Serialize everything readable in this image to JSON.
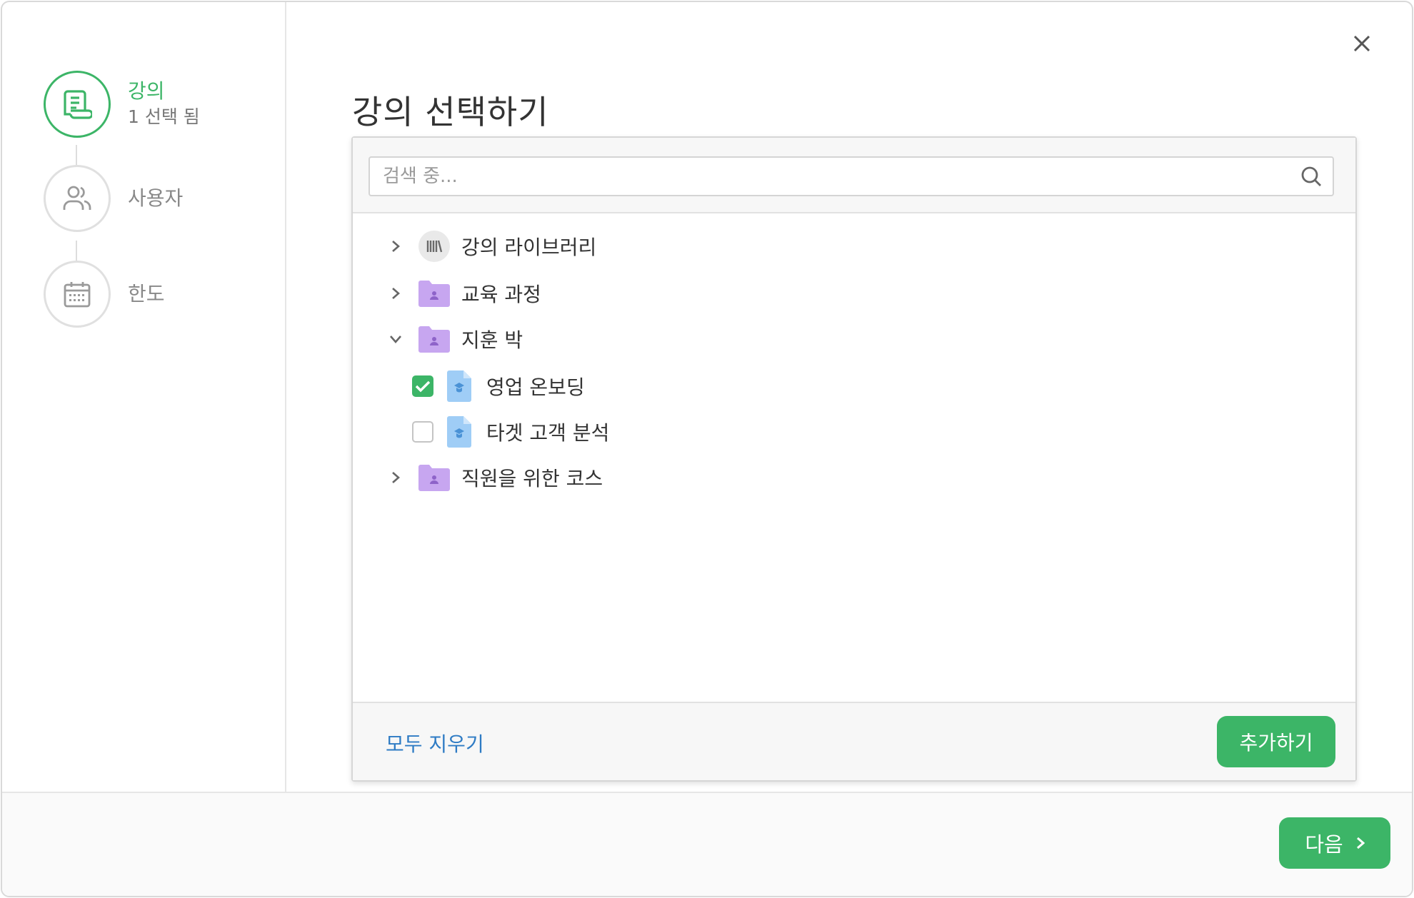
{
  "stepper": {
    "steps": [
      {
        "title": "강의",
        "sub": "1 선택 됨",
        "icon": "course-doc-icon",
        "active": true
      },
      {
        "title": "사용자",
        "sub": "",
        "icon": "users-icon",
        "active": false
      },
      {
        "title": "한도",
        "sub": "",
        "icon": "calendar-icon",
        "active": false
      }
    ]
  },
  "main": {
    "title": "강의 선택하기",
    "close_icon": "close-icon"
  },
  "search": {
    "placeholder": "검색 중...",
    "value": ""
  },
  "tree": {
    "items": [
      {
        "label": "강의 라이브러리",
        "icon": "library-icon",
        "expanded": false
      },
      {
        "label": "교육 과정",
        "icon": "folder-user-icon",
        "expanded": false
      },
      {
        "label": "지훈 박",
        "icon": "folder-user-icon",
        "expanded": true
      },
      {
        "label": "영업 온보딩",
        "icon": "course-file-icon",
        "checked": true
      },
      {
        "label": "타겟 고객 분석",
        "icon": "course-file-icon",
        "checked": false
      },
      {
        "label": "직원을 위한 코스",
        "icon": "folder-user-icon",
        "expanded": false
      }
    ]
  },
  "picker_footer": {
    "clear_label": "모두 지우기",
    "add_label": "추가하기"
  },
  "footer": {
    "next_label": "다음"
  },
  "colors": {
    "accent": "#3cb567",
    "link": "#2e7bc4",
    "folder": "#c7a6f0",
    "file": "#8cc4f5"
  }
}
